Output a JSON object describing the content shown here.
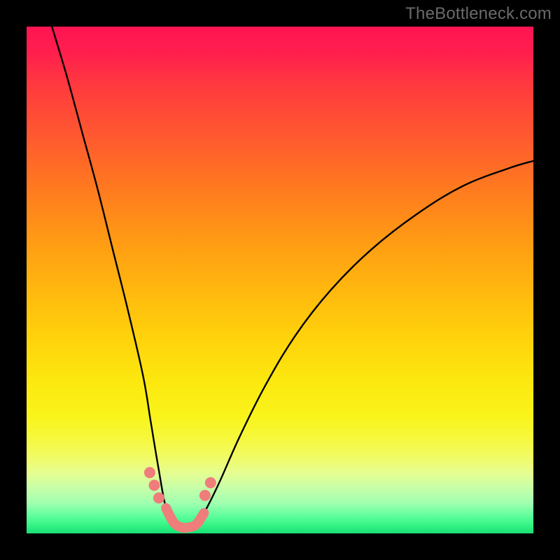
{
  "watermark": "TheBottleneck.com",
  "colors": {
    "frame": "#000000",
    "curve_main": "#000000",
    "curve_accent": "#ef7d7b",
    "gradient_top": "#ff1452",
    "gradient_bottom": "#18e074"
  },
  "chart_data": {
    "type": "line",
    "title": "",
    "xlabel": "",
    "ylabel": "",
    "xlim": [
      0,
      100
    ],
    "ylim": [
      0,
      100
    ],
    "grid": false,
    "legend": false,
    "notes": "Bottleneck-style V-curve. X and Y values are normalized 0–100 relative to the plot area; no axis tick labels visible.",
    "series": [
      {
        "name": "left-branch",
        "x": [
          5,
          8,
          11,
          14,
          17,
          20,
          23,
          24.5,
          26,
          27.5
        ],
        "y": [
          100,
          90,
          79,
          68,
          56,
          44,
          31,
          22,
          13,
          5
        ]
      },
      {
        "name": "valley",
        "x": [
          27.5,
          29,
          30.5,
          32,
          33.5,
          35
        ],
        "y": [
          5,
          2.2,
          1.2,
          1.2,
          1.8,
          4
        ]
      },
      {
        "name": "right-branch",
        "x": [
          35,
          38,
          42,
          47,
          53,
          60,
          68,
          77,
          86,
          95,
          100
        ],
        "y": [
          4,
          10,
          19,
          29,
          39,
          48,
          56,
          63,
          68.5,
          72,
          73.5
        ]
      },
      {
        "name": "accent-dots-left",
        "x": [
          24.3,
          25.2,
          26.1
        ],
        "y": [
          12,
          9.5,
          7
        ]
      },
      {
        "name": "accent-dots-right",
        "x": [
          35.2,
          36.3
        ],
        "y": [
          7.5,
          10
        ]
      },
      {
        "name": "accent-valley-stroke",
        "x": [
          27.5,
          29,
          30.5,
          32,
          33.5,
          35
        ],
        "y": [
          5,
          2.2,
          1.2,
          1.2,
          1.8,
          4
        ]
      }
    ]
  }
}
